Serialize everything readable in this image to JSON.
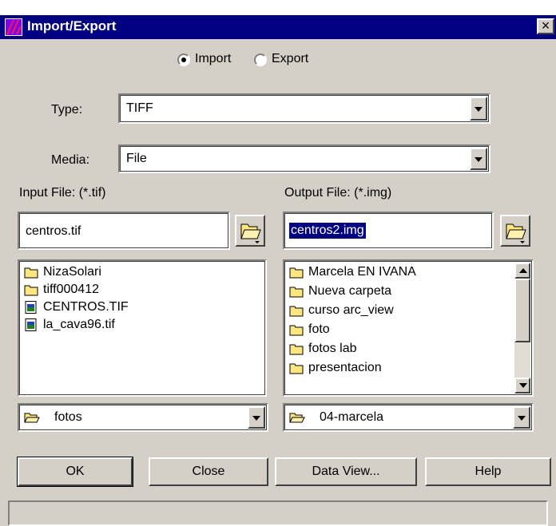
{
  "window": {
    "title": "Import/Export",
    "close_glyph": "×"
  },
  "mode": {
    "import_label": "Import",
    "export_label": "Export",
    "selected": "Import"
  },
  "type": {
    "label": "Type:",
    "value": "TIFF"
  },
  "media": {
    "label": "Media:",
    "value": "File"
  },
  "input": {
    "label": "Input File: (*.tif)",
    "value": "centros.tif",
    "files": [
      {
        "name": "NizaSolari",
        "icon": "folder-icon"
      },
      {
        "name": "tiff000412",
        "icon": "folder-icon"
      },
      {
        "name": "CENTROS.TIF",
        "icon": "image-file-icon"
      },
      {
        "name": "la_cava96.tif",
        "icon": "image-file-icon"
      }
    ],
    "directory": "fotos"
  },
  "output": {
    "label": "Output File: (*.img)",
    "value": "centros2.img",
    "files": [
      {
        "name": "Marcela EN IVANA",
        "icon": "folder-icon"
      },
      {
        "name": "Nueva carpeta",
        "icon": "folder-icon"
      },
      {
        "name": "curso arc_view",
        "icon": "folder-icon"
      },
      {
        "name": "foto",
        "icon": "folder-icon"
      },
      {
        "name": "fotos lab",
        "icon": "folder-icon"
      },
      {
        "name": "presentacion",
        "icon": "folder-icon"
      }
    ],
    "directory": "04-marcela"
  },
  "buttons": {
    "ok": "OK",
    "close": "Close",
    "data_view": "Data View...",
    "help": "Help"
  },
  "colors": {
    "title_bar": "#000080",
    "dialog_bg": "#d4d0c8",
    "selection": "#000080",
    "folder_yellow": "#ffe680"
  }
}
